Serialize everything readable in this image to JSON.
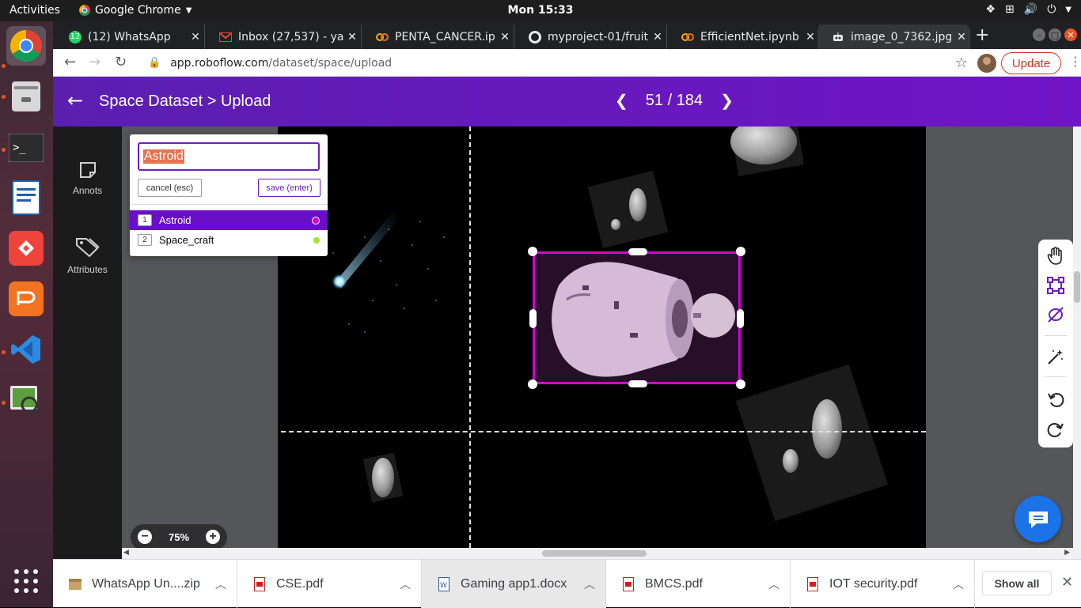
{
  "system": {
    "activities": "Activities",
    "app_name": "Google Chrome",
    "clock": "Mon 15:33"
  },
  "browser": {
    "tabs": [
      {
        "title": "(12) WhatsApp",
        "icon": "whatsapp-icon",
        "color": "#25d366",
        "badge": "12"
      },
      {
        "title": "Inbox (27,537) - yac",
        "icon": "gmail-icon",
        "color": "#ea4335"
      },
      {
        "title": "PENTA_CANCER.ip",
        "icon": "colab-icon",
        "color": "#f9ab00"
      },
      {
        "title": "myproject-01/fruit",
        "icon": "github-icon",
        "color": "#e8eaed"
      },
      {
        "title": "EfficientNet.ipynb",
        "icon": "colab-icon",
        "color": "#f9ab00"
      },
      {
        "title": "image_0_7362.jpg",
        "icon": "robot-icon",
        "color": "#e8eaed"
      }
    ],
    "url_host": "app.roboflow.com",
    "url_path": "/dataset/space/upload",
    "update_label": "Update"
  },
  "header": {
    "title": "Space Dataset > Upload",
    "current": "51",
    "total": "184",
    "pager_sep": " / "
  },
  "rail": {
    "items": [
      {
        "label": "Annots",
        "icon": "sticky-note-icon"
      },
      {
        "label": "Attributes",
        "icon": "tags-icon"
      }
    ]
  },
  "label_popup": {
    "input_value": "Astroid",
    "cancel_label": "cancel (esc)",
    "save_label": "save (enter)",
    "classes": [
      {
        "num": "1",
        "name": "Astroid",
        "color": "#d400d4",
        "selected": true
      },
      {
        "num": "2",
        "name": "Space_craft",
        "color": "#a6e22e",
        "selected": false
      }
    ]
  },
  "tools": [
    {
      "name": "hand-icon"
    },
    {
      "name": "bounding-box-icon"
    },
    {
      "name": "polygon-icon"
    },
    {
      "name": "magic-wand-icon"
    },
    {
      "name": "undo-icon"
    },
    {
      "name": "redo-icon"
    }
  ],
  "zoom": {
    "value": "75%"
  },
  "downloads": [
    {
      "name": "WhatsApp Un....zip",
      "type": "zip"
    },
    {
      "name": "CSE.pdf",
      "type": "pdf"
    },
    {
      "name": "Gaming app1.docx",
      "type": "docx"
    },
    {
      "name": "BMCS.pdf",
      "type": "pdf"
    },
    {
      "name": "IOT security.pdf",
      "type": "pdf"
    }
  ],
  "show_all_label": "Show all",
  "colors": {
    "brand_purple": "#6a0fc8",
    "box_magenta": "#d400d4",
    "chrome_red": "#d93025"
  }
}
